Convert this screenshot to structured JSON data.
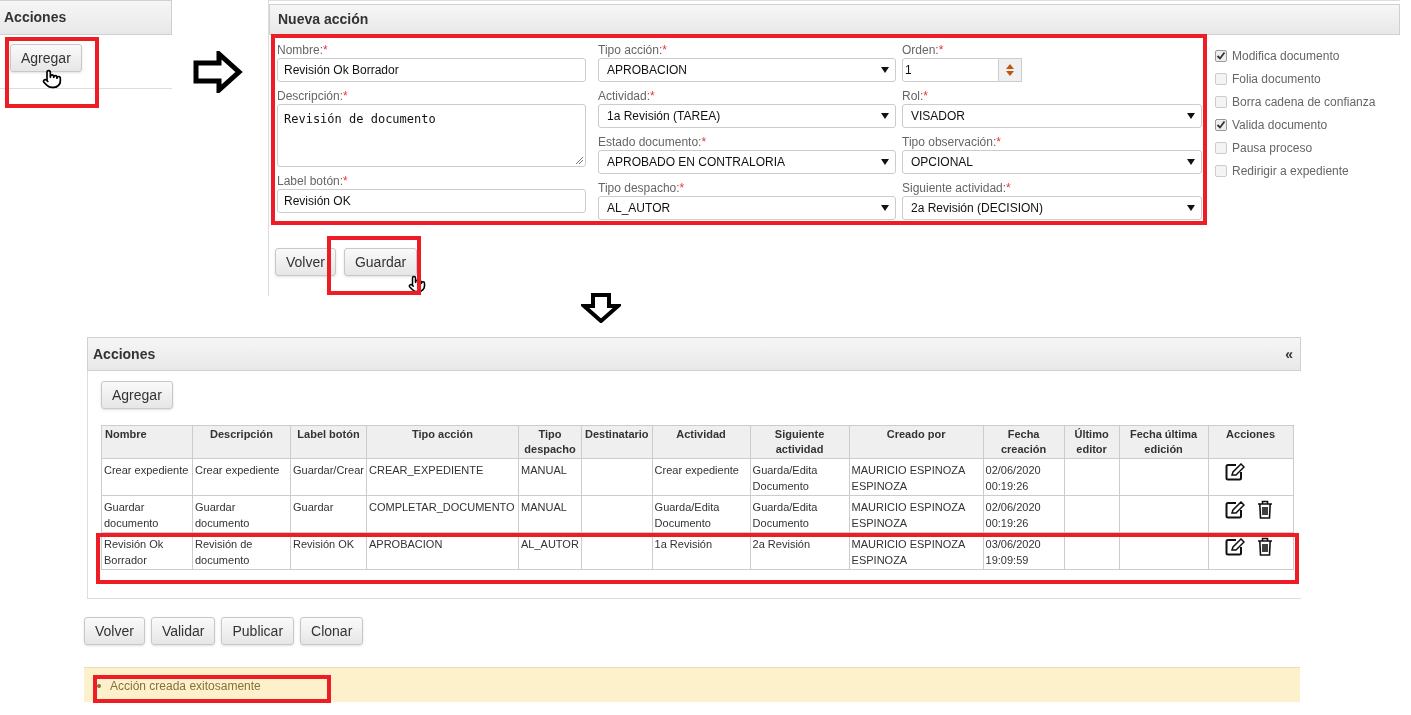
{
  "start_panel": {
    "title": "Acciones",
    "button": "Agregar"
  },
  "form": {
    "title": "Nueva acción",
    "columns": [
      [
        {
          "kind": "text",
          "label": "Nombre:",
          "mark": "*",
          "value": "Revisión Ok Borrador"
        },
        {
          "kind": "textarea",
          "label": "Descripción:",
          "mark": "*",
          "value": "Revisión de documento"
        },
        {
          "kind": "text",
          "label": "Label botón:",
          "mark": "*",
          "value": "Revisión OK"
        }
      ],
      [
        {
          "kind": "select",
          "label": "Tipo acción:",
          "mark": "*",
          "value": "APROBACION"
        },
        {
          "kind": "select",
          "label": "Actividad:",
          "mark": "*",
          "value": "1a Revisión (TAREA)"
        },
        {
          "kind": "select",
          "label": "Estado documento:",
          "mark": "*",
          "value": "APROBADO EN CONTRALORIA"
        },
        {
          "kind": "select",
          "label": "Tipo despacho:",
          "mark": "*",
          "value": "AL_AUTOR"
        }
      ],
      [
        {
          "kind": "number",
          "label": "Orden:",
          "mark": "*",
          "value": "1"
        },
        {
          "kind": "select",
          "label": "Rol:",
          "mark": "*",
          "value": "VISADOR"
        },
        {
          "kind": "select",
          "label": "Tipo observación:",
          "mark": "*",
          "value": "OPCIONAL"
        },
        {
          "kind": "select",
          "label": "Siguiente actividad:",
          "mark": "*",
          "value": "2a Revisión (DECISION)"
        }
      ]
    ],
    "checkboxes": [
      {
        "label": "Modifica documento",
        "checked": true
      },
      {
        "label": "Folia documento",
        "checked": false
      },
      {
        "label": "Borra cadena de confianza",
        "checked": false
      },
      {
        "label": "Valida documento",
        "checked": true
      },
      {
        "label": "Pausa proceso",
        "checked": false
      },
      {
        "label": "Redirigir a expediente",
        "checked": false
      }
    ],
    "buttons": [
      "Volver",
      "Guardar"
    ]
  },
  "actions_panel": {
    "title": "Acciones",
    "collapse": "«",
    "add_button": "Agregar",
    "table": {
      "columns": [
        "Nombre",
        "Descripción",
        "Label botón",
        "Tipo acción",
        "Tipo despacho",
        "Destinatario",
        "Actividad",
        "Siguiente actividad",
        "Creado por",
        "Fecha creación",
        "Último editor",
        "Fecha última edición",
        "Acciones"
      ],
      "rows": [
        {
          "cells": [
            "Crear expediente",
            "Crear expediente",
            "Guardar/Crear",
            "CREAR_EXPEDIENTE",
            "MANUAL",
            "",
            "Crear expediente",
            "Guarda/Edita Documento",
            "MAURICIO ESPINOZA ESPINOZA",
            "02/06/2020 00:19:26",
            "",
            ""
          ],
          "editable": true,
          "deletable": false
        },
        {
          "cells": [
            "Guardar documento",
            "Guardar documento",
            "Guardar",
            "COMPLETAR_DOCUMENTO",
            "MANUAL",
            "",
            "Guarda/Edita Documento",
            "Guarda/Edita Documento",
            "MAURICIO ESPINOZA ESPINOZA",
            "02/06/2020 00:19:26",
            "",
            ""
          ],
          "editable": true,
          "deletable": true
        },
        {
          "cells": [
            "Revisión Ok Borrador",
            "Revisión de documento",
            "Revisión OK",
            "APROBACION",
            "AL_AUTOR",
            "",
            "1a Revisión",
            "2a Revisión",
            "MAURICIO ESPINOZA ESPINOZA",
            "03/06/2020 19:09:59",
            "",
            ""
          ],
          "editable": true,
          "deletable": true
        }
      ]
    },
    "buttons": [
      "Volver",
      "Validar",
      "Publicar",
      "Clonar"
    ]
  },
  "messages": [
    "Acción creada exitosamente"
  ]
}
